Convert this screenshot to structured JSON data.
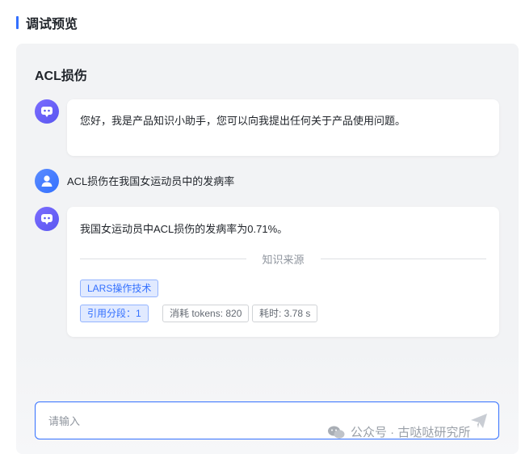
{
  "header": {
    "title": "调试预览"
  },
  "conversation": {
    "title": "ACL损伤",
    "messages": [
      {
        "role": "bot",
        "text": "您好，我是产品知识小助手，您可以向我提出任何关于产品使用问题。"
      },
      {
        "role": "user",
        "text": "ACL损伤在我国女运动员中的发病率"
      },
      {
        "role": "bot",
        "text": "我国女运动员中ACL损伤的发病率为0.71%。",
        "sources_label": "知识来源",
        "source_doc": "LARS操作技术",
        "citation": "引用分段：1",
        "tokens": "消耗 tokens: 820",
        "time": "耗时: 3.78 s"
      }
    ]
  },
  "input": {
    "placeholder": "请输入",
    "value": ""
  },
  "icons": {
    "bot": "robot-icon",
    "user": "user-icon",
    "send": "send-icon"
  },
  "colors": {
    "accent": "#3370ff",
    "bot_avatar": "#6b63f7",
    "panel": "#f2f3f5"
  },
  "watermark": {
    "text": "公众号 · 古哒哒研究所"
  }
}
